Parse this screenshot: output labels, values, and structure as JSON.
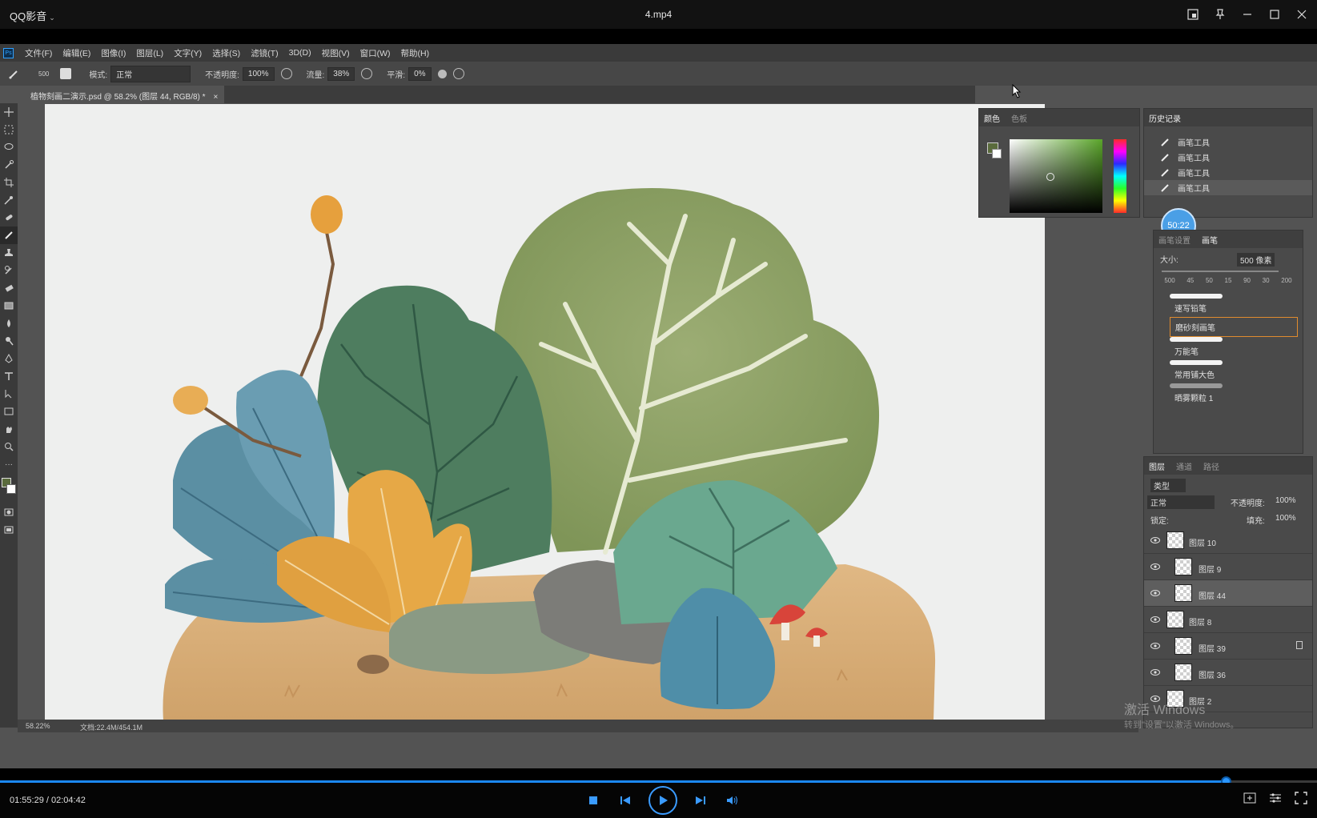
{
  "player": {
    "app_name": "QQ影音",
    "file_title": "4.mp4",
    "time_current": "01:55:29",
    "time_separator": " / ",
    "time_total": "02:04:42",
    "progress": 0.931
  },
  "photoshop": {
    "menu": [
      "文件(F)",
      "编辑(E)",
      "图像(I)",
      "图层(L)",
      "文字(Y)",
      "选择(S)",
      "滤镜(T)",
      "3D(D)",
      "视图(V)",
      "窗口(W)",
      "帮助(H)"
    ],
    "options": {
      "brush_size": "500",
      "mode_label": "模式:",
      "mode_value": "正常",
      "opacity_label": "不透明度:",
      "opacity_value": "100%",
      "flow_label": "流量:",
      "flow_value": "38%",
      "smooth_label": "平滑:",
      "smooth_value": "0%"
    },
    "document_tab": "植物刻画二演示.psd @ 58.2% (图层 44, RGB/8) *",
    "status": {
      "zoom": "58.22%",
      "doc_info": "文档:22.4M/454.1M"
    },
    "color_panel": {
      "tabs": [
        "颜色",
        "色板"
      ],
      "fg_color": "#5a6b3c"
    },
    "history_panel": {
      "title": "历史记录",
      "items": [
        "画笔工具",
        "画笔工具",
        "画笔工具",
        "画笔工具"
      ]
    },
    "brush_panel": {
      "tabs": [
        "画笔设置",
        "画笔"
      ],
      "size_label": "大小:",
      "size_value": "500 像素",
      "preset_sizes": [
        "500",
        "45",
        "50",
        "15",
        "90",
        "30",
        "200"
      ],
      "brushes": [
        "速写铅笔",
        "磨砂刻画笔",
        "万能笔",
        "常用铺大色",
        "晒雾颗粒 1"
      ],
      "selected_brush": "磨砂刻画笔"
    },
    "layers_panel": {
      "tabs": [
        "图层",
        "通道",
        "路径"
      ],
      "filter_label": "类型",
      "blend_mode": "正常",
      "opacity_label": "不透明度:",
      "opacity_value": "100%",
      "lock_label": "锁定:",
      "fill_label": "填充:",
      "fill_value": "100%",
      "layers": [
        "图层 10",
        "图层 9",
        "图层 44",
        "图层 8",
        "图层 39",
        "图层 36",
        "图层 2"
      ],
      "selected_layer": "图层 44"
    },
    "overlay_timer": "50:22"
  },
  "watermark": {
    "line1": "激活 Windows",
    "line2": "转到\"设置\"以激活 Windows。"
  },
  "colors": {
    "accent": "#1b88f3",
    "ps_blue": "#2fa0ff"
  }
}
